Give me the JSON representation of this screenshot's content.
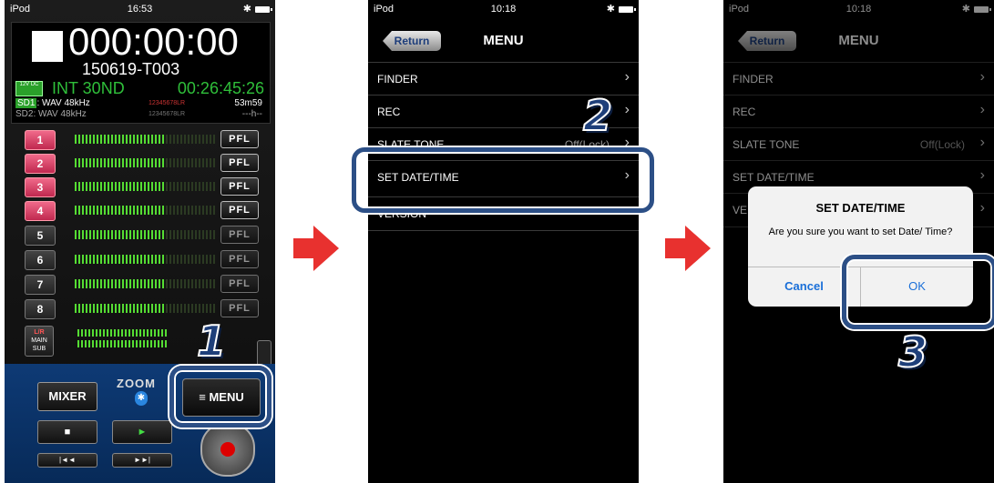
{
  "colors": {
    "highlight": "#2c4f86",
    "arrow": "#e8312f",
    "green": "#2fbf3a",
    "ios_blue": "#1a6fd8"
  },
  "phone1": {
    "status": {
      "carrier": "iPod",
      "time": "16:53",
      "bluetooth": "✱"
    },
    "timecode": "000:00:00",
    "take": "150619-T003",
    "battery_label": "12V DC",
    "input": "INT 30ND",
    "remaining_time": "00:26:45:26",
    "sd1": {
      "label": "SD1",
      "format": ": WAV 48kHz",
      "remain": "53m59",
      "tracks": "12345678LR"
    },
    "sd2": {
      "label": "SD2",
      "format": ": WAV 48kHz",
      "remain": "---h--",
      "tracks": "12345678LR"
    },
    "channels": [
      {
        "label": "1",
        "pfl": "PFL"
      },
      {
        "label": "2",
        "pfl": "PFL"
      },
      {
        "label": "3",
        "pfl": "PFL"
      },
      {
        "label": "4",
        "pfl": "PFL"
      },
      {
        "label": "5",
        "pfl": "PFL"
      },
      {
        "label": "6",
        "pfl": "PFL"
      },
      {
        "label": "7",
        "pfl": "PFL"
      },
      {
        "label": "8",
        "pfl": "PFL"
      }
    ],
    "main_button": {
      "line1": "L/R",
      "line2": "MAIN",
      "line3": "SUB"
    },
    "mixer_label": "MIXER",
    "logo": "ZOOM",
    "menu_label": "≡ MENU",
    "stop_icon": "■",
    "play_icon": "►",
    "rew_icon": "|◄◄",
    "ff_icon": "►►|",
    "step": "1"
  },
  "phone2": {
    "status": {
      "carrier": "iPod",
      "time": "10:18",
      "bluetooth": "✱"
    },
    "return_label": "Return",
    "title": "MENU",
    "items": [
      {
        "label": "FINDER",
        "value": ""
      },
      {
        "label": "REC",
        "value": ""
      },
      {
        "label": "SLATE TONE",
        "value": "Off(Lock)"
      },
      {
        "label": "SET DATE/TIME",
        "value": ""
      },
      {
        "label": "VERSION",
        "value": ""
      }
    ],
    "chevron": "›",
    "step": "2"
  },
  "phone3": {
    "status": {
      "carrier": "iPod",
      "time": "10:18",
      "bluetooth": "✱"
    },
    "return_label": "Return",
    "title": "MENU",
    "items": [
      {
        "label": "FINDER",
        "value": ""
      },
      {
        "label": "REC",
        "value": ""
      },
      {
        "label": "SLATE TONE",
        "value": "Off(Lock)"
      },
      {
        "label": "SET DATE/TIME",
        "value": ""
      },
      {
        "label": "VE",
        "value": ""
      }
    ],
    "chevron": "›",
    "dialog": {
      "title": "SET DATE/TIME",
      "message": "Are you sure you want to set Date/ Time?",
      "cancel": "Cancel",
      "ok": "OK"
    },
    "step": "3"
  }
}
